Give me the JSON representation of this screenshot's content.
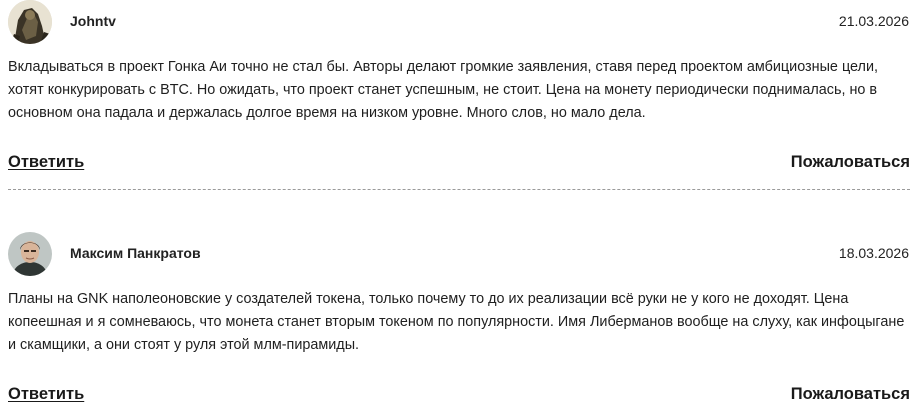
{
  "comments": [
    {
      "author": "Johntv",
      "date": "21.03.2026",
      "text": "Вкладываться в проект Гонка Аи точно не стал бы. Авторы делают громкие заявления, ставя перед проектом амбициозные цели, хотят конкурировать с BTC. Но ожидать, что проект станет успешным, не стоит. Цена на монету периодически поднималась, но в основном она падала и держалась долгое время на низком уровне. Много слов, но мало дела.",
      "reply_label": "Ответить",
      "report_label": "Пожаловаться",
      "avatar_icon": "user-avatar-photo-icon"
    },
    {
      "author": "Максим Панкратов",
      "date": "18.03.2026",
      "text": "Планы на GNK наполеоновские у создателей токена, только почему то до их реализации всё руки не у кого не доходят. Цена копеешная и я сомневаюсь, что монета станет вторым токеном по популярности. Имя Либерманов вообще на слуху, как инфоцыгане и скамщики, а они стоят у руля этой млм-пирамиды.",
      "reply_label": "Ответить",
      "report_label": "Пожаловаться",
      "avatar_icon": "user-avatar-photo-icon"
    }
  ],
  "colors": {
    "text": "#1f1f1f",
    "divider": "#9a9a9a",
    "background": "#ffffff"
  }
}
